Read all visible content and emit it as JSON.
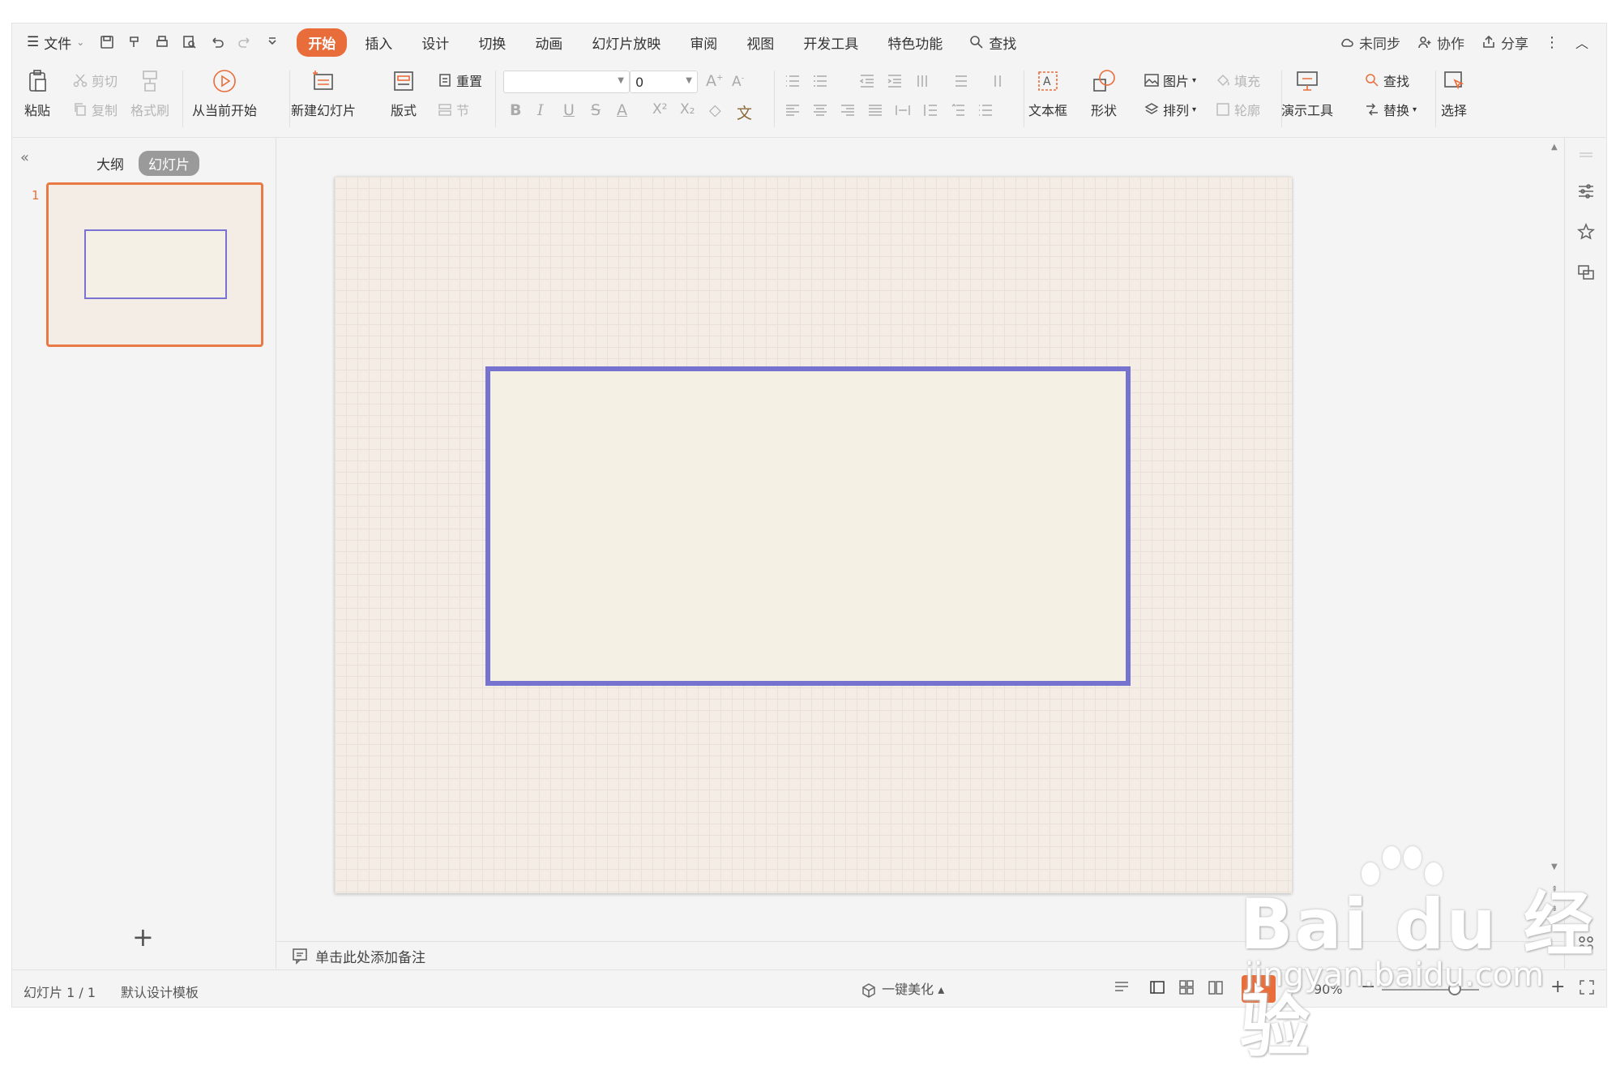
{
  "menubar": {
    "file_label": "文件",
    "tabs": [
      {
        "label": "开始",
        "active": true
      },
      {
        "label": "插入"
      },
      {
        "label": "设计"
      },
      {
        "label": "切换"
      },
      {
        "label": "动画"
      },
      {
        "label": "幻灯片放映"
      },
      {
        "label": "审阅"
      },
      {
        "label": "视图"
      },
      {
        "label": "开发工具"
      },
      {
        "label": "特色功能"
      }
    ],
    "search_label": "查找",
    "sync_label": "未同步",
    "collab_label": "协作",
    "share_label": "分享"
  },
  "ribbon": {
    "paste": "粘贴",
    "cut": "剪切",
    "copy": "复制",
    "format_painter": "格式刷",
    "from_current": "从当前开始",
    "new_slide": "新建幻灯片",
    "layout": "版式",
    "reset": "重置",
    "section": "节",
    "font_size_value": "0",
    "textbox": "文本框",
    "shape": "形状",
    "picture": "图片",
    "fill": "填充",
    "arrange": "排列",
    "outline": "轮廓",
    "presentation_tools": "演示工具",
    "find": "查找",
    "replace": "替换",
    "select": "选择"
  },
  "leftpanel": {
    "outline_tab": "大纲",
    "slides_tab": "幻灯片",
    "slide_number": "1",
    "add_symbol": "+"
  },
  "notes": {
    "placeholder": "单击此处添加备注"
  },
  "statusbar": {
    "slide_info": "幻灯片 1 / 1",
    "template": "默认设计模板",
    "beautify": "一键美化",
    "zoom": "90%"
  },
  "watermark": {
    "brand": "Bai du 经验",
    "url": "jingyan.baidu.com"
  },
  "colors": {
    "accent": "#e96d3a",
    "shape_border": "#7672d0",
    "slide_bg": "#f3ede6"
  }
}
